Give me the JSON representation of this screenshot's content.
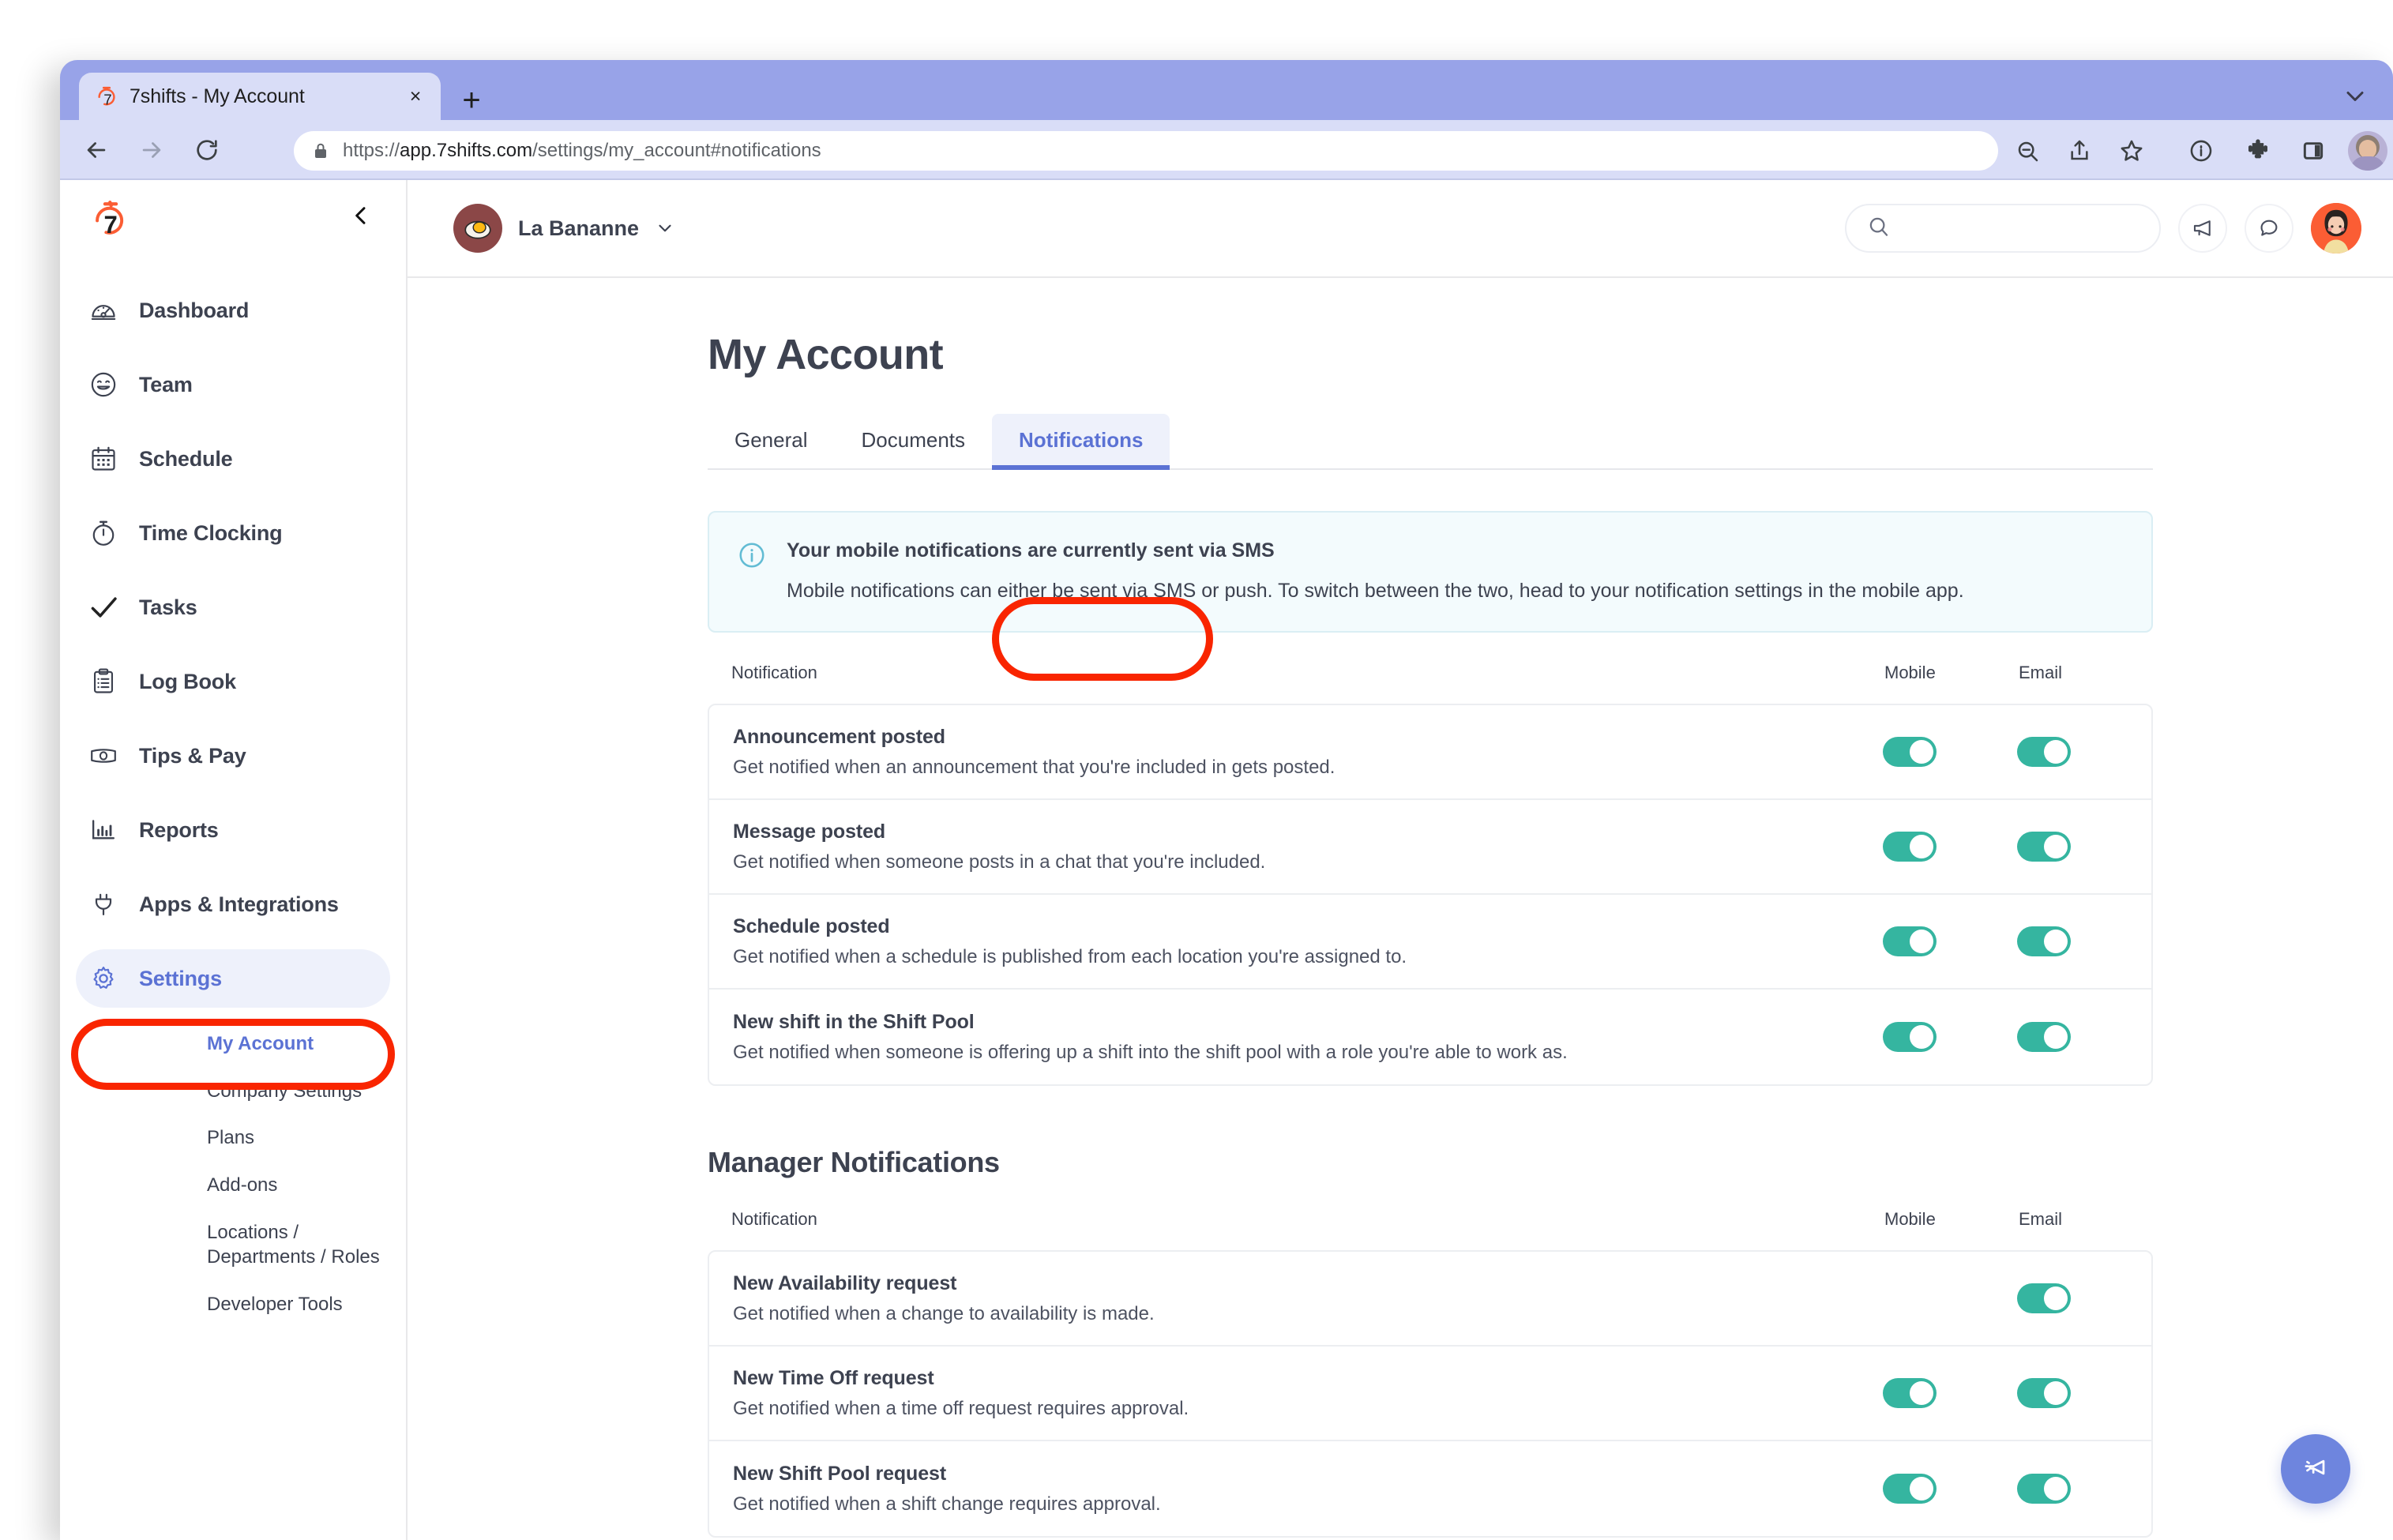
{
  "browser": {
    "tab_title": "7shifts - My Account",
    "tab_close_label": "×",
    "new_tab_label": "+",
    "url_prefix": "https://",
    "url_host": "app.7shifts.com",
    "url_path": "/settings/my_account#notifications",
    "icons": {
      "favicon": "7shifts-stopwatch-icon",
      "back": "back-arrow-icon",
      "forward": "forward-arrow-icon",
      "reload": "reload-icon",
      "lock": "lock-icon",
      "zoom_out": "zoom-out-icon",
      "share": "share-icon",
      "bookmark": "star-icon",
      "info": "info-circle-icon",
      "extensions": "puzzle-piece-icon",
      "side_panel": "side-panel-icon",
      "profile": "profile-avatar-icon",
      "menu": "three-dot-menu-icon",
      "tabstrip_chevron": "chevron-down-icon"
    }
  },
  "sidebar": {
    "logo": "7shifts-logo",
    "collapse_icon": "chevron-left-icon",
    "items": [
      {
        "label": "Dashboard",
        "icon": "gauge-icon",
        "active": false
      },
      {
        "label": "Team",
        "icon": "smiley-face-icon",
        "active": false
      },
      {
        "label": "Schedule",
        "icon": "calendar-icon",
        "active": false
      },
      {
        "label": "Time Clocking",
        "icon": "stopwatch-icon",
        "active": false
      },
      {
        "label": "Tasks",
        "icon": "checkmark-icon",
        "active": false
      },
      {
        "label": "Log Book",
        "icon": "clipboard-icon",
        "active": false
      },
      {
        "label": "Tips & Pay",
        "icon": "banknote-icon",
        "active": false
      },
      {
        "label": "Reports",
        "icon": "bar-chart-icon",
        "active": false
      },
      {
        "label": "Apps & Integrations",
        "icon": "plug-icon",
        "active": false
      },
      {
        "label": "Settings",
        "icon": "gear-icon",
        "active": true
      }
    ],
    "subitems": [
      {
        "label": "My Account",
        "active": true
      },
      {
        "label": "Company Settings",
        "active": false
      },
      {
        "label": "Plans",
        "active": false
      },
      {
        "label": "Add-ons",
        "active": false
      },
      {
        "label": "Locations / Departments / Roles",
        "active": false
      },
      {
        "label": "Developer Tools",
        "active": false
      }
    ]
  },
  "header": {
    "location_name": "La Bananne",
    "location_avatar": "fried-egg-avatar",
    "location_chevron": "chevron-down-icon",
    "search_placeholder": "",
    "search_value": "",
    "search_icon": "search-icon",
    "announcement_icon": "megaphone-icon",
    "chat_icon": "chat-bubble-icon",
    "user_avatar": "user-avatar"
  },
  "main": {
    "page_title": "My Account",
    "tabs": [
      {
        "label": "General",
        "active": false
      },
      {
        "label": "Documents",
        "active": false
      },
      {
        "label": "Notifications",
        "active": true
      }
    ],
    "banner": {
      "icon": "info-circle-icon",
      "title": "Your mobile notifications are currently sent via SMS",
      "body": "Mobile notifications can either be sent via SMS or push. To switch between the two, head to your notification settings in the mobile app."
    },
    "columns": {
      "notification": "Notification",
      "mobile": "Mobile",
      "email": "Email"
    },
    "personal_rows": [
      {
        "title": "Announcement posted",
        "description": "Get notified when an announcement that you're included in gets posted.",
        "mobile": true,
        "email": true
      },
      {
        "title": "Message posted",
        "description": "Get notified when someone posts in a chat that you're included.",
        "mobile": true,
        "email": true
      },
      {
        "title": "Schedule posted",
        "description": "Get notified when a schedule is published from each location you're assigned to.",
        "mobile": true,
        "email": true
      },
      {
        "title": "New shift in the Shift Pool",
        "description": "Get notified when someone is offering up a shift into the shift pool with a role you're able to work as.",
        "mobile": true,
        "email": true
      }
    ],
    "manager_section_title": "Manager Notifications",
    "manager_rows": [
      {
        "title": "New Availability request",
        "description": "Get notified when a change to availability is made.",
        "mobile": null,
        "email": true
      },
      {
        "title": "New Time Off request",
        "description": "Get notified when a time off request requires approval.",
        "mobile": true,
        "email": true
      },
      {
        "title": "New Shift Pool request",
        "description": "Get notified when a shift change requires approval.",
        "mobile": true,
        "email": true
      }
    ],
    "fab_icon": "megaphone-icon"
  },
  "annotations": {
    "settings_highlight": "red-ellipse-settings",
    "notifications_tab_highlight": "red-ellipse-notifications-tab",
    "color": "#f92500"
  },
  "colors": {
    "accent_blue": "#5b72d4",
    "toggle_on": "#35b5a0",
    "brand_orange": "#fb5d34",
    "annotation_red": "#f92500"
  }
}
